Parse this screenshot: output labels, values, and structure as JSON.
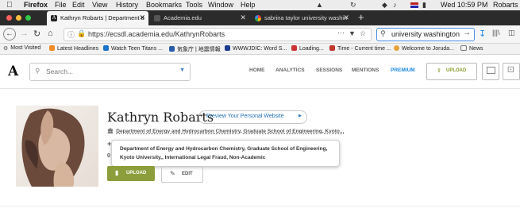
{
  "menubar": {
    "app": "Firefox",
    "items": [
      "File",
      "Edit",
      "View",
      "History",
      "Bookmarks",
      "Tools",
      "Window",
      "Help"
    ],
    "clock": "Wed 10:59 PM",
    "user": "Robarts K"
  },
  "tabs": [
    {
      "title": "Kathryn Robarts | Department o",
      "active": true
    },
    {
      "title": "Academia.edu",
      "active": false
    },
    {
      "title": "sabrina taylor university washin",
      "active": false
    }
  ],
  "nav": {
    "url": "https://ecsdl.academia.edu/KathrynRobarts",
    "search_value": "university washington"
  },
  "bookmarks": [
    "Most Visited",
    "Latest Headlines",
    "Watch Teen Titans ...",
    "気象庁 | 地震情報",
    "WWWJDIC: Word S...",
    "Loading...",
    "Time - Current time ...",
    "Welcome to Joruda...",
    "News"
  ],
  "site": {
    "logo": "A",
    "search_placeholder": "Search...",
    "nav_links": [
      "HOME",
      "ANALYTICS",
      "SESSIONS",
      "MENTIONS",
      "PREMIUM"
    ],
    "upload_label": "UPLOAD"
  },
  "profile": {
    "name": "Kathryn Robarts",
    "preview_label": "Preview Your Personal Website",
    "department_short": "Department of Energy and Hydrocarbon Chemistry, Graduate School of Engineering, Kyoto...",
    "tooltip_line1": "Department of Energy and Hydrocarbon Chemistry, Graduate School of Engineering,",
    "tooltip_line2": "Kyoto University,, International Legal Fraud, Non-Academic",
    "stat_prefix": "0",
    "upload_label": "UPLOAD",
    "edit_label": "EDIT"
  },
  "colors": {
    "premium": "#1e88e5",
    "upload_green": "#8c9e3b",
    "tab_bar": "#2b2b2b"
  }
}
